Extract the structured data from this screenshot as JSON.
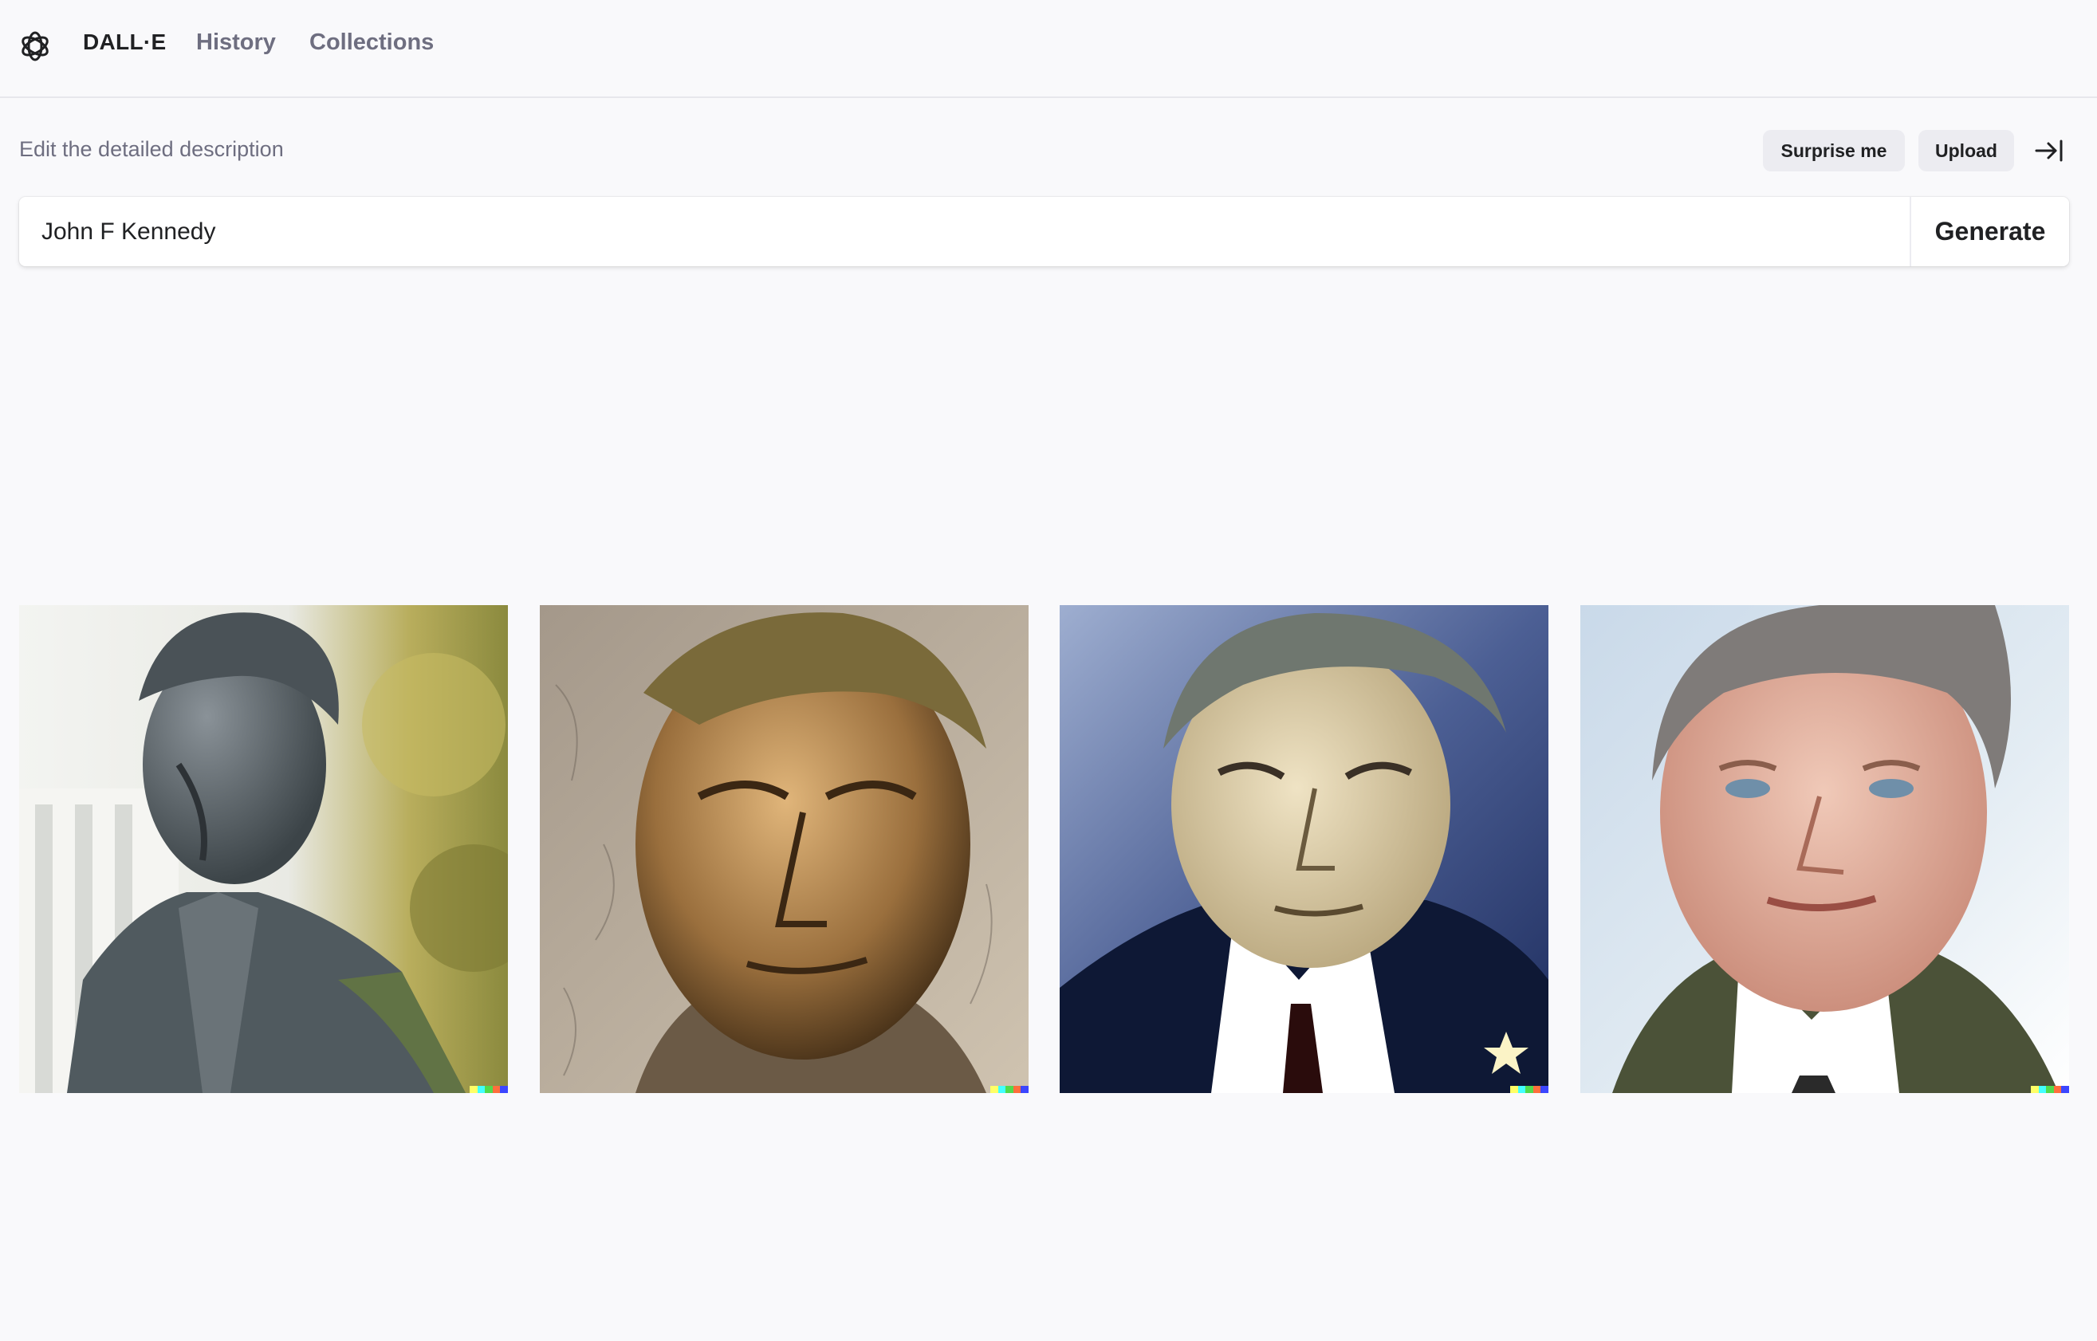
{
  "header": {
    "brand": "DALL·E",
    "nav": [
      {
        "label": "History"
      },
      {
        "label": "Collections"
      }
    ]
  },
  "editor": {
    "hint": "Edit the detailed description",
    "surprise_label": "Surprise me",
    "upload_label": "Upload",
    "prompt_value": "John F Kennedy",
    "generate_label": "Generate"
  },
  "results": {
    "tiles": [
      {
        "style": "bronze statue portrait"
      },
      {
        "style": "stone bust portrait"
      },
      {
        "style": "illustrated portrait"
      },
      {
        "style": "painted portrait"
      }
    ]
  },
  "colors": {
    "background": "#f9f9fb",
    "chip": "#ececf1",
    "text": "#202123",
    "muted": "#6e6e80",
    "watermark": [
      "#ffff66",
      "#42ffff",
      "#51da4c",
      "#ff6e3c",
      "#3c46ff"
    ]
  }
}
